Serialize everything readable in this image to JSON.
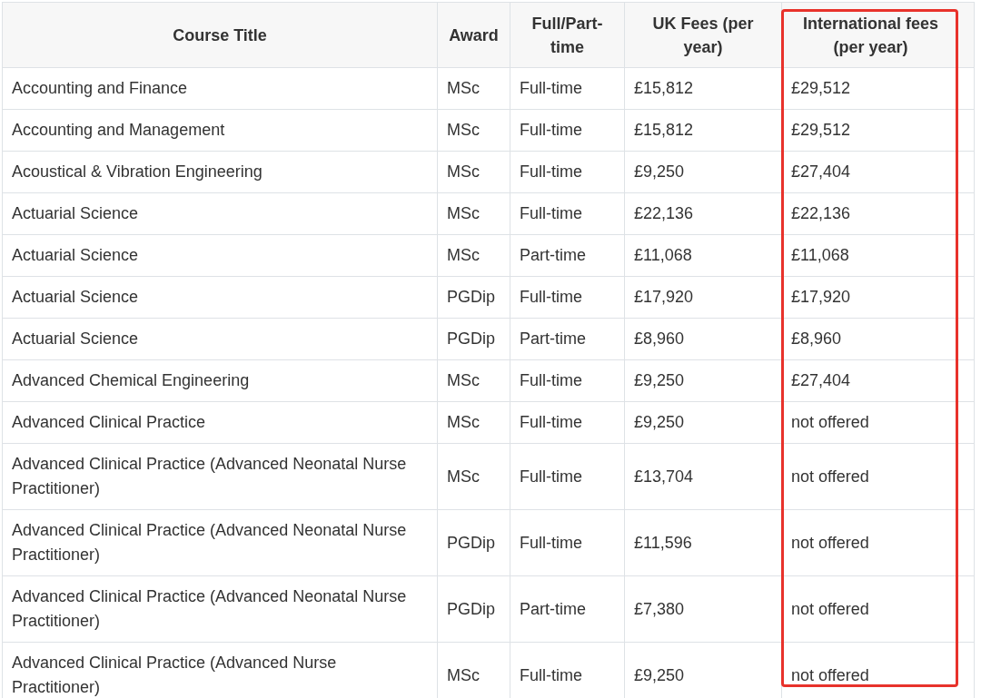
{
  "table": {
    "columns": [
      {
        "label": "Course Title",
        "highlighted": false
      },
      {
        "label": "Award",
        "highlighted": false
      },
      {
        "label": "Full/Part-time",
        "highlighted": false
      },
      {
        "label": "UK Fees (per year)",
        "highlighted": false
      },
      {
        "label": "International fees (per year)",
        "highlighted": true
      }
    ],
    "rows": [
      [
        "Accounting and Finance",
        "MSc",
        "Full-time",
        "£15,812",
        "£29,512"
      ],
      [
        "Accounting and Management",
        "MSc",
        "Full-time",
        "£15,812",
        "£29,512"
      ],
      [
        "Acoustical & Vibration Engineering",
        "MSc",
        "Full-time",
        "£9,250",
        "£27,404"
      ],
      [
        "Actuarial Science",
        "MSc",
        "Full-time",
        "£22,136",
        "£22,136"
      ],
      [
        "Actuarial Science",
        "MSc",
        "Part-time",
        "£11,068",
        "£11,068"
      ],
      [
        "Actuarial Science",
        "PGDip",
        "Full-time",
        "£17,920",
        "£17,920"
      ],
      [
        "Actuarial Science",
        "PGDip",
        "Part-time",
        "£8,960",
        "£8,960"
      ],
      [
        "Advanced Chemical Engineering",
        "MSc",
        "Full-time",
        "£9,250",
        "£27,404"
      ],
      [
        "Advanced Clinical Practice",
        "MSc",
        "Full-time",
        "£9,250",
        "not offered"
      ],
      [
        "Advanced Clinical Practice (Advanced Neonatal Nurse Practitioner)",
        "MSc",
        "Full-time",
        "£13,704",
        "not offered"
      ],
      [
        "Advanced Clinical Practice (Advanced Neonatal Nurse Practitioner)",
        "PGDip",
        "Full-time",
        "£11,596",
        "not offered"
      ],
      [
        "Advanced Clinical Practice (Advanced Neonatal Nurse Practitioner)",
        "PGDip",
        "Part-time",
        "£7,380",
        "not offered"
      ],
      [
        "Advanced Clinical Practice (Advanced Nurse Practitioner)",
        "MSc",
        "Full-time",
        "£9,250",
        "not offered"
      ]
    ]
  }
}
